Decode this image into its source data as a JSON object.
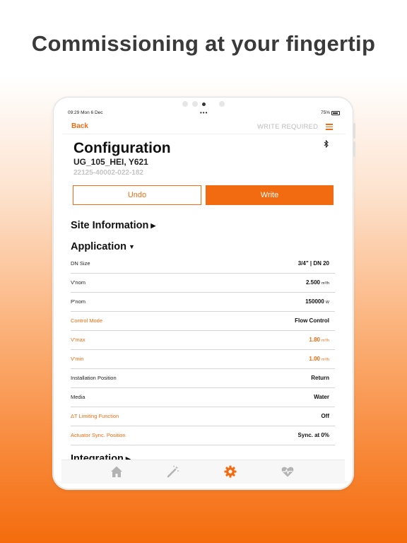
{
  "headline": "Commissioning at your fingertip",
  "status_bar": {
    "time": "09:29  Mon 6 Dec",
    "dots": "•••",
    "battery": "75%"
  },
  "nav": {
    "back_label": "Back",
    "write_required_label": "WRITE REQUIRED",
    "menu_icon": "hamburger-icon"
  },
  "header": {
    "title": "Configuration",
    "subtitle": "UG_105_HEI, Y621",
    "serial": "22125-40002-022-182",
    "bluetooth_icon": "bluetooth-icon"
  },
  "actions": {
    "undo_label": "Undo",
    "write_label": "Write"
  },
  "sections": {
    "site_information": "Site Information",
    "application": "Application",
    "integration": "Integration"
  },
  "rows": [
    {
      "label": "DN Size",
      "value": "3/4\" | DN 20",
      "unit": "",
      "highlight": false
    },
    {
      "label": "V'nom",
      "value": "2.500",
      "unit": "m³/h",
      "highlight": false
    },
    {
      "label": "P'nom",
      "value": "150000",
      "unit": "W",
      "highlight": false
    },
    {
      "label": "Control Mode",
      "value": "Flow Control",
      "unit": "",
      "highlight": true
    },
    {
      "label": "V'max",
      "value": "1.80",
      "unit": "m³/h",
      "highlight": true
    },
    {
      "label": "V'min",
      "value": "1.00",
      "unit": "m³/h",
      "highlight": true
    },
    {
      "label": "Installation Position",
      "value": "Return",
      "unit": "",
      "highlight": false
    },
    {
      "label": "Media",
      "value": "Water",
      "unit": "",
      "highlight": false
    },
    {
      "label": "ΔT Limiting Function",
      "value": "Off",
      "unit": "",
      "highlight": true
    },
    {
      "label": "Actuator Sync. Position",
      "value": "Sync. at 0%",
      "unit": "",
      "highlight": true
    }
  ],
  "tabs": [
    {
      "icon": "home-icon",
      "active": false
    },
    {
      "icon": "magic-wand-icon",
      "active": false
    },
    {
      "icon": "gear-icon",
      "active": true
    },
    {
      "icon": "heart-pulse-icon",
      "active": false
    }
  ],
  "colors": {
    "accent": "#f26b11",
    "inactive_tab": "#b3b3b3",
    "write_required": "#bdbdbd"
  }
}
